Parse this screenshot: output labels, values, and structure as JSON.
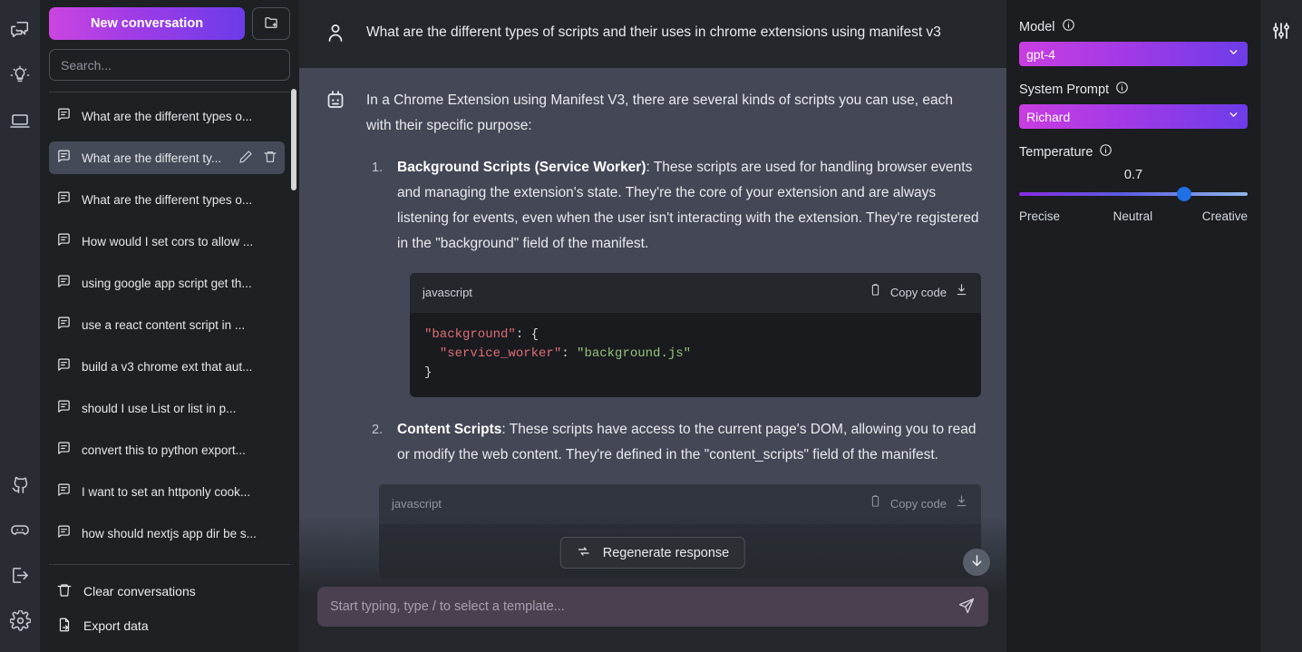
{
  "rail": {
    "top_icons": [
      {
        "name": "chat-bubbles-icon",
        "label": "Chats"
      },
      {
        "name": "lightbulb-icon",
        "label": "Prompts"
      },
      {
        "name": "laptop-icon",
        "label": "Desktop"
      }
    ],
    "bottom_icons": [
      {
        "name": "github-icon",
        "label": "GitHub"
      },
      {
        "name": "discord-icon",
        "label": "Discord"
      },
      {
        "name": "logout-icon",
        "label": "Sign out"
      },
      {
        "name": "gear-icon",
        "label": "Settings"
      }
    ]
  },
  "sidebar": {
    "new_conversation_label": "New conversation",
    "new_folder_icon": "folder-plus-icon",
    "search": {
      "placeholder": "Search...",
      "value": ""
    },
    "conversations": [
      {
        "title": "What are the different types o...",
        "active": false
      },
      {
        "title": "What are the different ty...",
        "active": true
      },
      {
        "title": "What are the different types o...",
        "active": false
      },
      {
        "title": "How would I set cors to allow ...",
        "active": false
      },
      {
        "title": "using google app script get th...",
        "active": false
      },
      {
        "title": "use a react content script in ...",
        "active": false
      },
      {
        "title": "build a v3 chrome ext that aut...",
        "active": false
      },
      {
        "title": "should I use List or list in p...",
        "active": false
      },
      {
        "title": "convert this to python export...",
        "active": false
      },
      {
        "title": "I want to set an httponly cook...",
        "active": false
      },
      {
        "title": "how should nextjs app dir be s...",
        "active": false
      }
    ],
    "actions": [
      {
        "label": "Clear conversations",
        "icon": "trash-icon"
      },
      {
        "label": "Export data",
        "icon": "export-file-icon"
      }
    ]
  },
  "chat": {
    "user_message": "What are the different types of scripts and their uses in chrome extensions using manifest v3",
    "assistant_intro": "In a Chrome Extension using Manifest V3, there are several kinds of scripts you can use, each with their specific purpose:",
    "items": [
      {
        "title": "Background Scripts (Service Worker)",
        "text": ": These scripts are used for handling browser events and managing the extension's state. They're the core of your extension and are always listening for events, even when the user isn't interacting with the extension. They're registered in the \"background\" field of the manifest."
      },
      {
        "title": "Content Scripts",
        "text": ": These scripts have access to the current page's DOM, allowing you to read or modify the web content. They're defined in the \"content_scripts\" field of the manifest."
      }
    ],
    "code_block": {
      "language": "javascript",
      "copy_label": "Copy code",
      "download_icon": "download-icon",
      "copy_icon": "clipboard-icon",
      "line1_key": "\"background\"",
      "line1_punc": ": {",
      "line2_key": "\"service_worker\"",
      "line2_sep": ": ",
      "line2_val": "\"background.js\"",
      "line3": "}"
    },
    "code_block_2": {
      "language": "javascript",
      "copy_label": "Copy code"
    },
    "regenerate_label": "Regenerate response",
    "regenerate_icon": "refresh-icon",
    "scroll_down_icon": "arrow-down-icon",
    "composer": {
      "placeholder": "Start typing, type / to select a template...",
      "value": "",
      "send_icon": "send-icon"
    }
  },
  "settings_panel": {
    "model": {
      "label": "Model",
      "info_icon": "info-icon",
      "value": "gpt-4",
      "options": [
        "gpt-4"
      ]
    },
    "system_prompt": {
      "label": "System Prompt",
      "info_icon": "info-icon",
      "value": "Richard",
      "options": [
        "Richard"
      ]
    },
    "temperature": {
      "label": "Temperature",
      "info_icon": "info-icon",
      "value": "0.7",
      "min_label": "Precise",
      "mid_label": "Neutral",
      "max_label": "Creative"
    },
    "toggle_icon": "sliders-icon"
  },
  "colors": {
    "accent_start": "#c93ee0",
    "accent_end": "#6d3ce9",
    "slider_thumb": "#1f6fe5",
    "assistant_bg": "#434756",
    "user_bg": "#24282c"
  }
}
